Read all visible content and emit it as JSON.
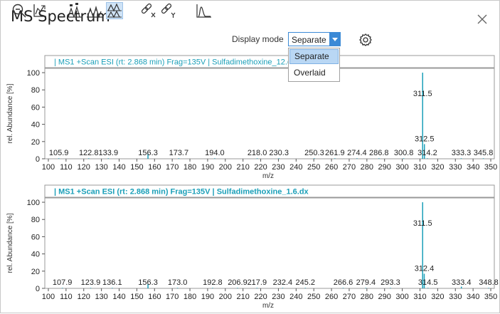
{
  "window": {
    "title": "MS Spectrum"
  },
  "toolbar": {
    "icons": [
      "zoom-out-icon",
      "axis-autoscale-icon",
      "peak-labels-icon",
      "overlay-spectra-icon",
      "stacked-spectra-icon",
      "link-x-icon",
      "link-y-icon",
      "profile-icon",
      "gear-icon"
    ],
    "display_mode_label": "Display mode",
    "display_mode_value": "Separate",
    "display_mode_options": [
      "Separate",
      "Overlaid"
    ]
  },
  "colors": {
    "accent": "#1a9fb8",
    "select_border": "#3c8ad6",
    "selected_bg": "#b9d7f4"
  },
  "plots": [
    {
      "header": "| MS1 +Scan ESI (rt: 2.868 min) Frag=135V | Sulfadimethoxine_12.dx",
      "xlabel": "m/z",
      "ylabel": "rel. Abundance [%]",
      "xlim": [
        98,
        352
      ],
      "ylim": [
        0,
        105
      ],
      "xticks": [
        100,
        110,
        120,
        130,
        140,
        150,
        160,
        170,
        180,
        190,
        200,
        210,
        220,
        230,
        240,
        250,
        260,
        270,
        280,
        290,
        300,
        310,
        320,
        330,
        340,
        350
      ],
      "yticks": [
        0,
        20,
        40,
        60,
        80,
        100
      ],
      "peaks": [
        {
          "x": 105.9,
          "y": 0.6,
          "label": "105.9"
        },
        {
          "x": 122.8,
          "y": 0.6,
          "label": "122.8"
        },
        {
          "x": 133.9,
          "y": 0.6,
          "label": "133.9"
        },
        {
          "x": 156.3,
          "y": 6,
          "label": "156.3"
        },
        {
          "x": 173.7,
          "y": 0.6,
          "label": "173.7"
        },
        {
          "x": 194.0,
          "y": 0.6,
          "label": "194.0"
        },
        {
          "x": 218.0,
          "y": 0.6,
          "label": "218.0"
        },
        {
          "x": 230.3,
          "y": 0.6,
          "label": "230.3"
        },
        {
          "x": 250.3,
          "y": 0.6,
          "label": "250.3"
        },
        {
          "x": 261.9,
          "y": 0.6,
          "label": "261.9"
        },
        {
          "x": 274.4,
          "y": 0.6,
          "label": "274.4"
        },
        {
          "x": 286.8,
          "y": 0.6,
          "label": "286.8"
        },
        {
          "x": 300.8,
          "y": 0.6,
          "label": "300.8"
        },
        {
          "x": 311.5,
          "y": 100,
          "label": "311.5"
        },
        {
          "x": 312.5,
          "y": 17,
          "label": "312.5"
        },
        {
          "x": 314.2,
          "y": 0.6,
          "label": "314.2"
        },
        {
          "x": 333.3,
          "y": 0.6,
          "label": "333.3"
        },
        {
          "x": 345.8,
          "y": 0.6,
          "label": "345.8"
        }
      ]
    },
    {
      "header": "| MS1 +Scan ESI (rt: 2.868 min) Frag=135V | Sulfadimethoxine_1.6.dx",
      "xlabel": "m/z",
      "ylabel": "rel. Abundance [%]",
      "xlim": [
        98,
        352
      ],
      "ylim": [
        0,
        105
      ],
      "xticks": [
        100,
        110,
        120,
        130,
        140,
        150,
        160,
        170,
        180,
        190,
        200,
        210,
        220,
        230,
        240,
        250,
        260,
        270,
        280,
        290,
        300,
        310,
        320,
        330,
        340,
        350
      ],
      "yticks": [
        0,
        20,
        40,
        60,
        80,
        100
      ],
      "peaks": [
        {
          "x": 107.9,
          "y": 0.6,
          "label": "107.9"
        },
        {
          "x": 123.9,
          "y": 0.6,
          "label": "123.9"
        },
        {
          "x": 136.1,
          "y": 0.6,
          "label": "136.1"
        },
        {
          "x": 156.3,
          "y": 5,
          "label": "156.3"
        },
        {
          "x": 173.0,
          "y": 0.6,
          "label": "173.0"
        },
        {
          "x": 192.8,
          "y": 0.6,
          "label": "192.8"
        },
        {
          "x": 206.9,
          "y": 0.6,
          "label": "206.9"
        },
        {
          "x": 217.9,
          "y": 0.6,
          "label": "217.9"
        },
        {
          "x": 232.4,
          "y": 0.6,
          "label": "232.4"
        },
        {
          "x": 245.2,
          "y": 0.6,
          "label": "245.2"
        },
        {
          "x": 266.6,
          "y": 0.6,
          "label": "266.6"
        },
        {
          "x": 279.4,
          "y": 0.6,
          "label": "279.4"
        },
        {
          "x": 293.3,
          "y": 0.6,
          "label": "293.3"
        },
        {
          "x": 311.5,
          "y": 100,
          "label": "311.5"
        },
        {
          "x": 312.4,
          "y": 17,
          "label": "312.4"
        },
        {
          "x": 314.5,
          "y": 0.6,
          "label": "314.5"
        },
        {
          "x": 333.4,
          "y": 2,
          "label": "333.4"
        },
        {
          "x": 348.8,
          "y": 0.6,
          "label": "348.8"
        }
      ]
    }
  ]
}
